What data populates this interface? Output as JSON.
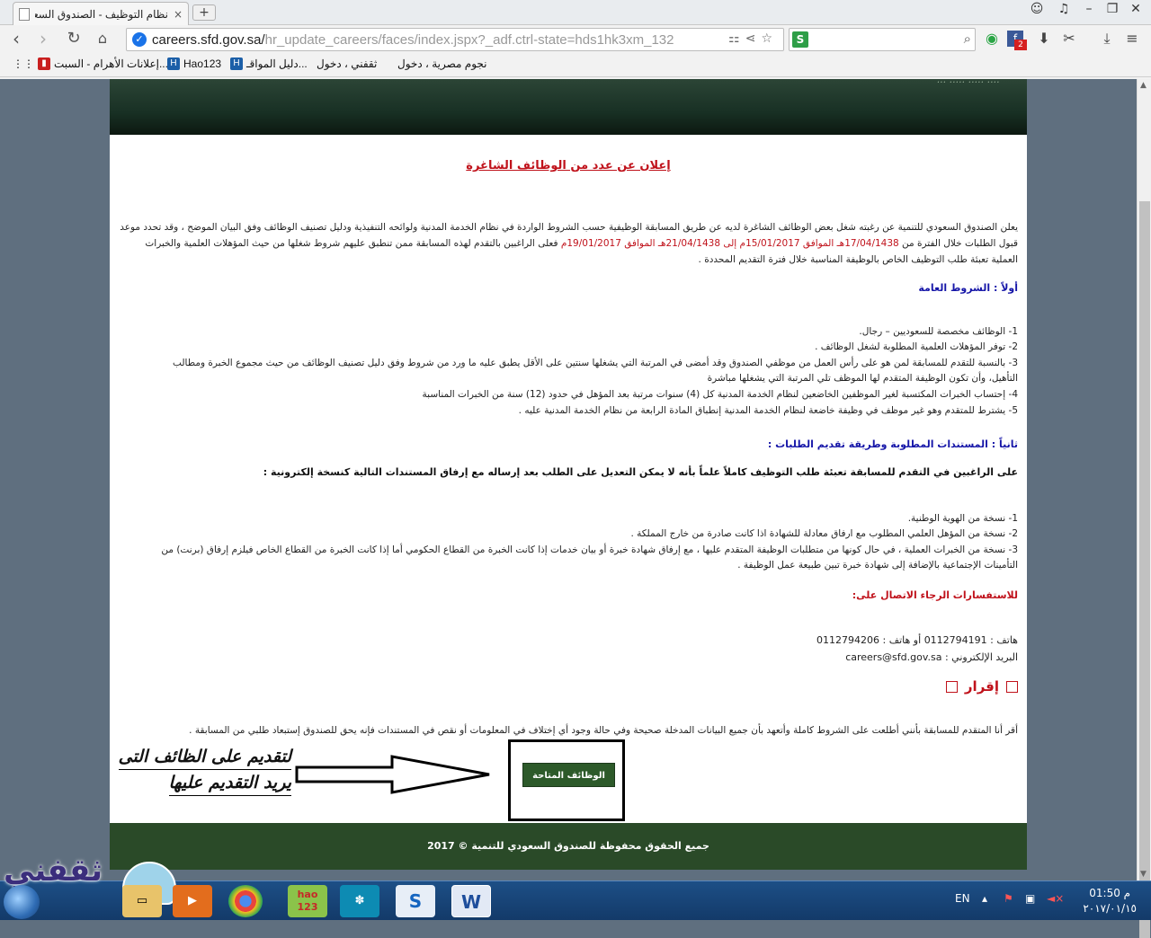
{
  "browser": {
    "tab_title": "نظام التوظيف - الصندوق السعودي",
    "tab_close": "×",
    "new_tab": "+",
    "url_host": "careers.sfd.gov.sa/",
    "url_path": "hr_update_careers/faces/index.jspx?_adf.ctrl-state=hds1hk3xm_132",
    "search_value": "",
    "bookmarks": [
      {
        "label": "نجوم مصرية ، دخول"
      },
      {
        "label": "ثقفني ، دخول"
      },
      {
        "label": "دليل المواقـ..."
      },
      {
        "label": "Hao123"
      },
      {
        "label": "إعلانات الأهرام - السبت..."
      }
    ],
    "extension_badge": "2"
  },
  "page": {
    "banner_tag": "... ..... ..... ....",
    "title": "إعلان عن عدد من الوظائف الشاغرة",
    "intro": {
      "part1": "يعلن الصندوق السعودي للتنمية عن رغبته شغل بعض الوظائف الشاغرة لديه عن طريق المسابقة الوظيفية حسب الشروط الواردة في نظام الخدمة المدنية ولوائحه التنفيذية ودليل تصنيف الوظائف وفق البيان الموضح ، وقد تحدد موعد قبول الطلبات خلال الفترة من ",
      "date1": "17/04/1438هـ الموافق 15/01/2017م إلى 21/04/1438هـ الموافق 19/01/2017م",
      "part2": " فعلى الراغبين بالتقدم لهذه المسابقة ممن تنطبق عليهم شروط شغلها من حيث المؤهلات العلمية والخبرات العملية تعبئة طلب التوظيف الخاص بالوظيفة المناسبة خلال فترة التقديم المحددة ."
    },
    "section1_heading": "أولاً : الشروط العامة",
    "conditions": [
      "1- الوظائف مخصصة للسعوديين – رجال.",
      "2- توفر المؤهلات العلمية المطلوبة لشغل الوظائف .",
      "3- بالنسبة للتقدم للمسابقة لمن هو على رأس العمل من موظفي الصندوق وقد أمضى في المرتبة التي يشغلها سنتين على الأقل يطبق عليه ما ورد من شروط وفق دليل تصنيف الوظائف من حيث مجموع الخبرة ومطالب",
      "التأهيل، وأن تكون الوظيفة المتقدم لها الموظف تلي المرتبة التي يشغلها مباشرة",
      "4- إحتساب الخبرات المكتسبة لغير الموظفين الخاضعين لنظام الخدمة المدنية كل (4) سنوات مرتبة بعد المؤهل في حدود (12) سنة من الخبرات المناسبة",
      "5- يشترط للمتقدم وهو غير موظف في وظيفة خاضعة لنظام الخدمة المدنية إنطباق المادة الرابعة من نظام الخدمة المدنية عليه ."
    ],
    "section2_heading": "ثانياً : المستندات المطلوبة وطريقة تقديم الطلبات :",
    "section2_notice": "على الراغبين في التقدم للمسابقة تعبئة طلب التوظيف كاملاً علماً بأنه لا يمكن التعديل على الطلب بعد إرساله مع إرفاق المستندات التالية كنسخة إلكترونية :",
    "documents": [
      "1- نسخة من الهوية الوطنية.",
      "2- نسخة من المؤهل العلمي المطلوب مع ارفاق معادلة للشهادة اذا كانت صادرة من خارج المملكة .",
      "3- نسخة من الخبرات العملية ، في حال كونها من متطلبات الوظيفة المتقدم عليها ، مع إرفاق شهادة خبرة أو بيان خدمات إذا كانت الخبرة من القطاع الحكومي أما إذا كانت الخبرة من القطاع الخاص فيلزم إرفاق (برنت) من",
      "التأمينات الإجتماعية بالإضافة إلى شهادة خبرة تبين طبيعة عمل الوظيفة ."
    ],
    "inquiries_heading": "للاستفسارات الرجاء الاتصال على:",
    "phone_line": "هاتف : 0112794191 أو هاتف : 0112794206",
    "email_line": "البريد الإلكتروني : careers@sfd.gov.sa",
    "declaration_title": "إقرار",
    "declaration_text": "أقر أنا المتقدم للمسابقة بأنني أطلعت على الشروط كاملة وأتعهد بأن جميع البيانات المدخلة صحيحة وفي حالة وجود أي إختلاف في المعلومات أو نقص في المستندات فإنه يحق للصندوق إستبعاد طلبي من المسابقة .",
    "jobs_button": "الوظائف المتاحة",
    "annotation_line1": "لتقديم على الظائف التى",
    "annotation_line2": "يريد التقديم عليها",
    "footer": "جميع الحقوق محفوظة للصندوق السعودي للتنمية © 2017"
  },
  "taskbar": {
    "watermark": "ثقفني",
    "language": "EN",
    "time": "01:50 م",
    "date": "٢٠١٧/٠١/١٥",
    "apps": [
      {
        "label": "hao 123"
      },
      {
        "label": "W"
      }
    ]
  },
  "colors": {
    "banner": "#183024",
    "footer": "#2a4a28",
    "title_red": "#c0121b",
    "heading_blue": "#1616a8",
    "button_green": "#2d5a2a"
  }
}
